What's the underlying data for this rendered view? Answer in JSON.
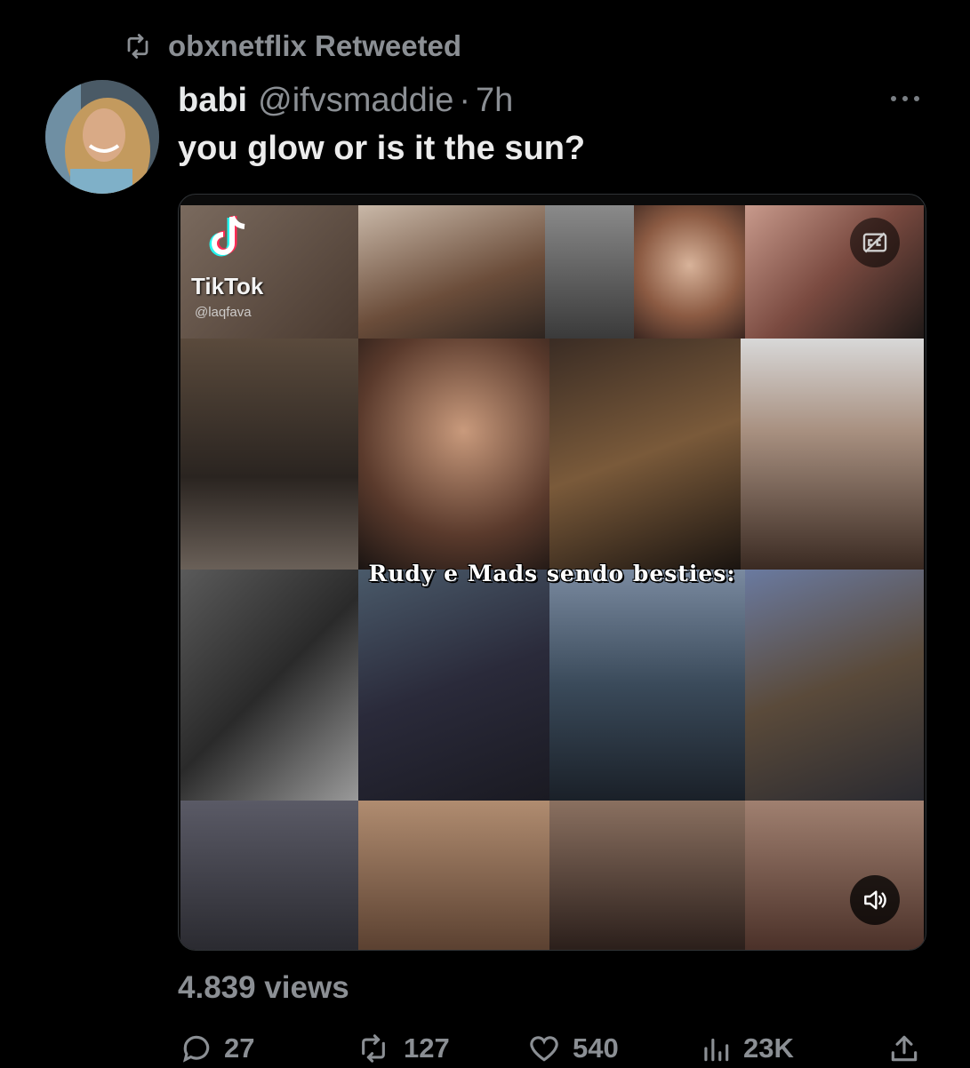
{
  "retweet": {
    "icon": "retweet-icon",
    "label": "obxnetflix Retweeted"
  },
  "author": {
    "name": "babi",
    "handle": "@ifvsmaddie",
    "separator": "·",
    "time": "7h"
  },
  "tweet": {
    "text": "you glow or is it the sun?"
  },
  "media": {
    "tiktok_label": "TikTok",
    "tiktok_user": "@laqfava",
    "caption": "Rudy e Mads sendo besties:",
    "cc_icon": "captions-off-icon",
    "volume_icon": "volume-icon"
  },
  "stats": {
    "views": "4.839 views"
  },
  "actions": {
    "replies": "27",
    "retweets": "127",
    "likes": "540",
    "views": "23K"
  },
  "colors": {
    "background": "#000000",
    "text": "#e7e9ea",
    "muted": "#8b8f94",
    "border": "#2f3336"
  }
}
